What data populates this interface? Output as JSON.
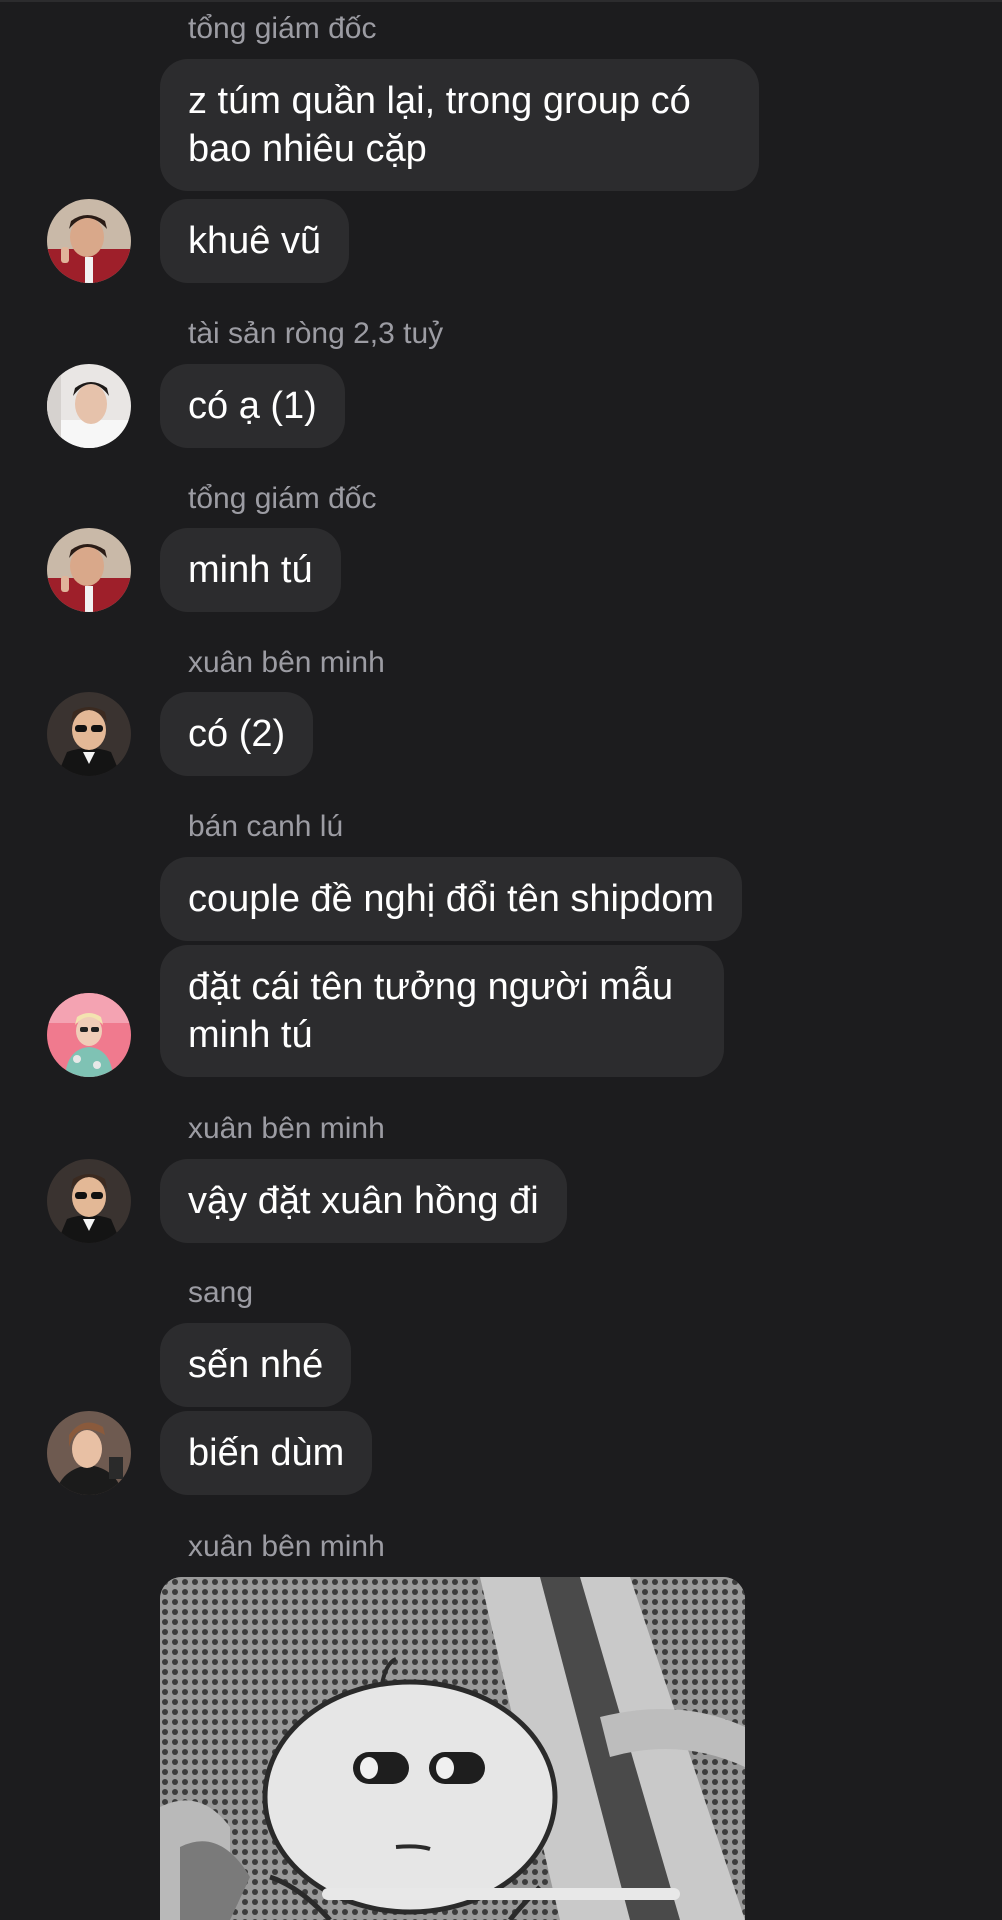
{
  "messages": [
    {
      "sender": "tổng giám đốc",
      "bubbles": [
        "z túm quần lại, trong group có bao nhiêu cặp",
        "khuê vũ"
      ]
    },
    {
      "sender": "tài sản ròng 2,3 tuỷ",
      "bubbles": [
        "có ạ (1)"
      ]
    },
    {
      "sender": "tổng giám đốc",
      "bubbles": [
        "minh tú"
      ]
    },
    {
      "sender": "xuân bên minh",
      "bubbles": [
        "có (2)"
      ]
    },
    {
      "sender": "bán canh lú",
      "bubbles": [
        "couple đề nghị đổi tên shipdom",
        "đặt cái tên tưởng người mẫu minh tú"
      ]
    },
    {
      "sender": "xuân bên minh",
      "bubbles": [
        "vậy đặt xuân hồng đi"
      ]
    },
    {
      "sender": "sang",
      "bubbles": [
        "sến nhé",
        "biến dùm"
      ]
    },
    {
      "sender": "xuân bên minh",
      "sticker": "meme-sticker"
    }
  ],
  "colors": {
    "background": "#1c1c1e",
    "bubble": "#2c2c2e",
    "sender_text": "#9c9ca3",
    "message_text": "#ffffff"
  }
}
